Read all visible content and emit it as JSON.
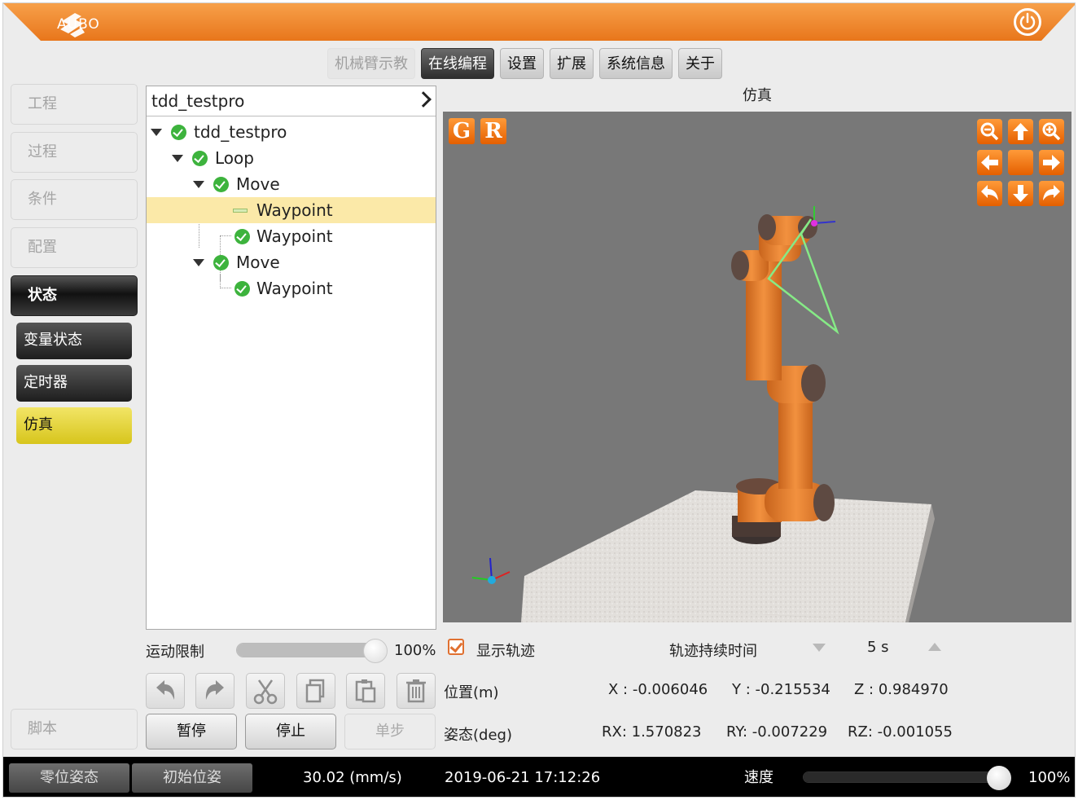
{
  "header": {
    "brand": "AUBO"
  },
  "topnav": [
    {
      "label": "机械臂示教",
      "state": "disabled"
    },
    {
      "label": "在线编程",
      "state": "active"
    },
    {
      "label": "设置",
      "state": "normal"
    },
    {
      "label": "扩展",
      "state": "normal"
    },
    {
      "label": "系统信息",
      "state": "normal"
    },
    {
      "label": "关于",
      "state": "normal"
    }
  ],
  "sidebar": {
    "items": [
      "工程",
      "过程",
      "条件",
      "配置",
      "状态"
    ],
    "active": "状态",
    "sub": [
      "变量状态",
      "定时器",
      "仿真"
    ],
    "sub_active": "仿真",
    "script": "脚本"
  },
  "tree": {
    "header": "tdd_testpro",
    "nodes": [
      {
        "label": "tdd_testpro",
        "depth": 0,
        "expandable": true,
        "status": "ok"
      },
      {
        "label": "Loop",
        "depth": 1,
        "expandable": true,
        "status": "ok"
      },
      {
        "label": "Move",
        "depth": 2,
        "expandable": true,
        "status": "ok"
      },
      {
        "label": "Waypoint",
        "depth": 3,
        "expandable": false,
        "status": "current",
        "selected": true
      },
      {
        "label": "Waypoint",
        "depth": 3,
        "expandable": false,
        "status": "ok"
      },
      {
        "label": "Move",
        "depth": 2,
        "expandable": true,
        "status": "ok"
      },
      {
        "label": "Waypoint",
        "depth": 3,
        "expandable": false,
        "status": "ok"
      }
    ]
  },
  "sim": {
    "title": "仿真",
    "g_label": "G",
    "r_label": "R"
  },
  "controls": {
    "motion_limit_label": "运动限制",
    "motion_limit_value": "100%",
    "motion_limit_fraction": 1.0,
    "show_trace_label": "显示轨迹",
    "show_trace_checked": true,
    "trace_duration_label": "轨迹持续时间",
    "trace_duration_value": "5 s",
    "pause": "暂停",
    "stop": "停止",
    "step": "单步"
  },
  "pose": {
    "position_label": "位置(m)",
    "x": "X : -0.006046",
    "y": "Y : -0.215534",
    "z": "Z : 0.984970",
    "orientation_label": "姿态(deg)",
    "rx": "RX:  1.570823",
    "ry": "RY: -0.007229",
    "rz": "RZ: -0.001055"
  },
  "statusbar": {
    "zero_pose": "零位姿态",
    "init_pose": "初始位姿",
    "speed_readout": "30.02  (mm/s)",
    "datetime": "2019-06-21 17:12:26",
    "speed_label": "速度",
    "speed_value": "100%",
    "speed_fraction": 1.0
  },
  "colors": {
    "accent": "#f07f1e",
    "sim_bg": "#787878",
    "robot": "#e8823a",
    "trajectory": "#7fe07f",
    "selected_row": "#fbe9a8",
    "sub_active": "#e6d537"
  }
}
